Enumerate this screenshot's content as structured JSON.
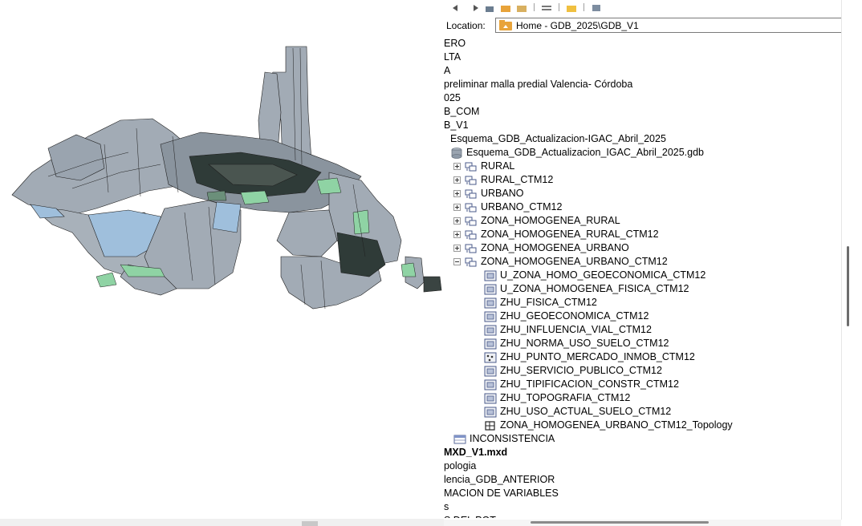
{
  "colors": {
    "parcel_fill": "#a2abb5",
    "parcel_stroke": "#1f1f1f",
    "parcel_blue": "#9fbfdc",
    "parcel_green": "#8fd3a4",
    "parcel_dark": "#2f3b38",
    "folder_icon": "#e8a33a",
    "gdb_icon": "#8e9aa8"
  },
  "catalog": {
    "location_label": "Location:",
    "location_value": "Home - GDB_2025\\GDB_V1",
    "location_icon": "home-folder-icon",
    "dropdown_icon": "chevron-down-icon"
  },
  "tree": [
    {
      "text": "ERO",
      "icon": "",
      "indent": 0
    },
    {
      "text": "LTA",
      "icon": "",
      "indent": 0
    },
    {
      "text": "A",
      "icon": "",
      "indent": 0
    },
    {
      "text": " preliminar malla predial Valencia- Córdoba",
      "icon": "",
      "indent": 0
    },
    {
      "text": "025",
      "icon": "",
      "indent": 0
    },
    {
      "text": "B_COM",
      "icon": "",
      "indent": 0
    },
    {
      "text": "B_V1",
      "icon": "",
      "indent": 0
    },
    {
      "text": "Esquema_GDB_Actualizacion-IGAC_Abril_2025",
      "icon": "",
      "indent": 1
    },
    {
      "text": "Esquema_GDB_Actualizacion_IGAC_Abril_2025.gdb",
      "icon": "gdb-icon",
      "indent": 2
    },
    {
      "text": "RURAL",
      "icon": "feature-dataset-icon",
      "indent": 3,
      "exp": "plus"
    },
    {
      "text": "RURAL_CTM12",
      "icon": "feature-dataset-icon",
      "indent": 3,
      "exp": "plus"
    },
    {
      "text": "URBANO",
      "icon": "feature-dataset-icon",
      "indent": 3,
      "exp": "plus"
    },
    {
      "text": "URBANO_CTM12",
      "icon": "feature-dataset-icon",
      "indent": 3,
      "exp": "plus"
    },
    {
      "text": "ZONA_HOMOGENEA_RURAL",
      "icon": "feature-dataset-icon",
      "indent": 3,
      "exp": "plus"
    },
    {
      "text": "ZONA_HOMOGENEA_RURAL_CTM12",
      "icon": "feature-dataset-icon",
      "indent": 3,
      "exp": "plus"
    },
    {
      "text": "ZONA_HOMOGENEA_URBANO",
      "icon": "feature-dataset-icon",
      "indent": 3,
      "exp": "plus"
    },
    {
      "text": "ZONA_HOMOGENEA_URBANO_CTM12",
      "icon": "feature-dataset-icon",
      "indent": 3,
      "exp": "minus"
    },
    {
      "text": "U_ZONA_HOMO_GEOECONOMICA_CTM12",
      "icon": "polygon-feature-class-icon",
      "indent": 4
    },
    {
      "text": "U_ZONA_HOMOGENEA_FISICA_CTM12",
      "icon": "polygon-feature-class-icon",
      "indent": 4
    },
    {
      "text": "ZHU_FISICA_CTM12",
      "icon": "polygon-feature-class-icon",
      "indent": 4
    },
    {
      "text": "ZHU_GEOECONOMICA_CTM12",
      "icon": "polygon-feature-class-icon",
      "indent": 4
    },
    {
      "text": "ZHU_INFLUENCIA_VIAL_CTM12",
      "icon": "polygon-feature-class-icon",
      "indent": 4
    },
    {
      "text": "ZHU_NORMA_USO_SUELO_CTM12",
      "icon": "polygon-feature-class-icon",
      "indent": 4
    },
    {
      "text": "ZHU_PUNTO_MERCADO_INMOB_CTM12",
      "icon": "point-feature-class-icon",
      "indent": 4
    },
    {
      "text": "ZHU_SERVICIO_PUBLICO_CTM12",
      "icon": "polygon-feature-class-icon",
      "indent": 4
    },
    {
      "text": "ZHU_TIPIFICACION_CONSTR_CTM12",
      "icon": "polygon-feature-class-icon",
      "indent": 4
    },
    {
      "text": "ZHU_TOPOGRAFIA_CTM12",
      "icon": "polygon-feature-class-icon",
      "indent": 4
    },
    {
      "text": "ZHU_USO_ACTUAL_SUELO_CTM12",
      "icon": "polygon-feature-class-icon",
      "indent": 4
    },
    {
      "text": "ZONA_HOMOGENEA_URBANO_CTM12_Topology",
      "icon": "topology-icon",
      "indent": 4
    },
    {
      "text": "INCONSISTENCIA",
      "icon": "table-icon",
      "indent": 3
    },
    {
      "text": "MXD_V1.mxd",
      "icon": "",
      "indent": 0,
      "bold": true
    },
    {
      "text": "pologia",
      "icon": "",
      "indent": 0
    },
    {
      "text": "lencia_GDB_ANTERIOR",
      "icon": "",
      "indent": 0
    },
    {
      "text": "MACION DE VARIABLES",
      "icon": "",
      "indent": 0
    },
    {
      "text": "s",
      "icon": "",
      "indent": 0
    },
    {
      "text": "S DEL POT",
      "icon": "",
      "indent": 0
    }
  ]
}
